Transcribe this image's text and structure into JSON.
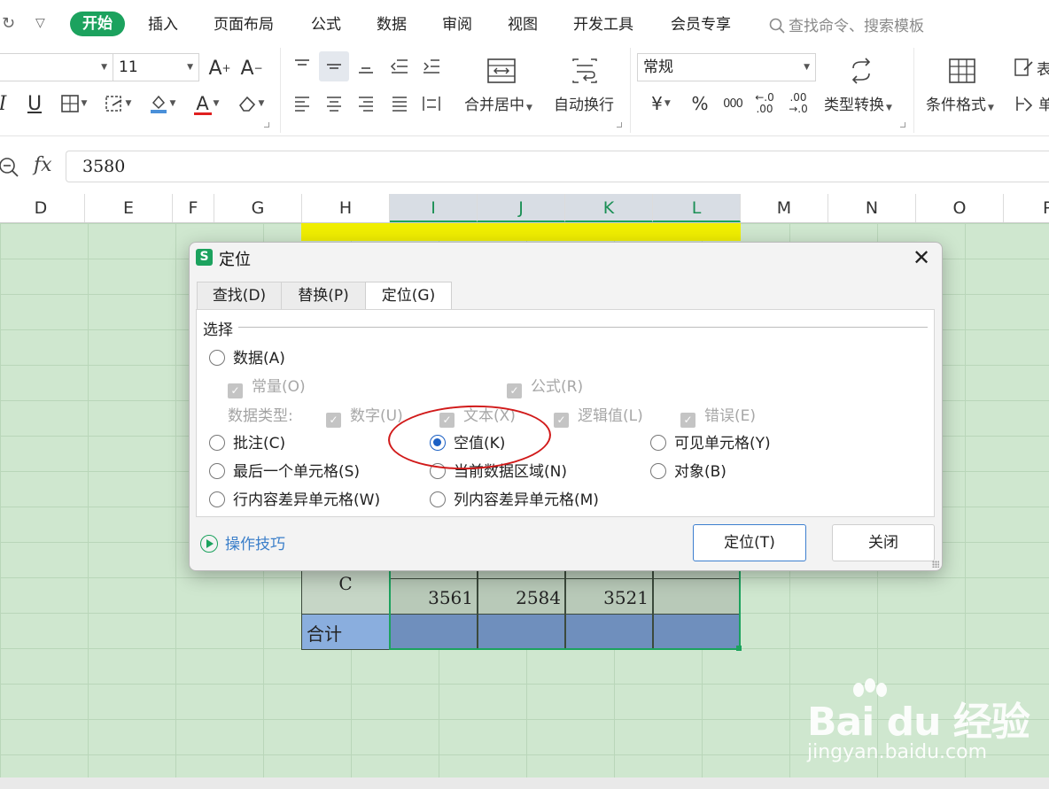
{
  "menu": {
    "tabs": [
      "开始",
      "插入",
      "页面布局",
      "公式",
      "数据",
      "审阅",
      "视图",
      "开发工具",
      "会员专享"
    ],
    "search_placeholder": "查找命令、搜索模板"
  },
  "ribbon": {
    "font_size": "11",
    "merge_label": "合并居中",
    "wrap_label": "自动换行",
    "number_format": "常规",
    "convert_label": "类型转换",
    "cond_format_label": "条件格式",
    "percent_symbol": "%",
    "thousands_symbol": "000",
    "inc_decimal": "←.0 .00",
    "dec_decimal": ".00 →.0",
    "currency_symbol": "¥",
    "cut_off_right_1": "表",
    "cut_off_right_2": "单"
  },
  "formula_bar": {
    "fx_label": "fx",
    "value": "3580"
  },
  "columns": [
    "D",
    "E",
    "F",
    "G",
    "H",
    "I",
    "J",
    "K",
    "L",
    "M",
    "N",
    "O",
    "P"
  ],
  "sheet": {
    "row_c_label": "C",
    "row_c_values": [
      "3561",
      "2584",
      "3521",
      ""
    ],
    "total_label": "合计"
  },
  "dialog": {
    "title": "定位",
    "tabs": [
      "查找(D)",
      "替换(P)",
      "定位(G)"
    ],
    "active_tab": "定位(G)",
    "group_label": "选择",
    "options": {
      "data": "数据(A)",
      "constant": "常量(O)",
      "formula": "公式(R)",
      "data_type_label": "数据类型:",
      "number": "数字(U)",
      "text": "文本(X)",
      "logical": "逻辑值(L)",
      "error": "错误(E)",
      "comment": "批注(C)",
      "blank": "空值(K)",
      "visible_cells": "可见单元格(Y)",
      "last_cell": "最后一个单元格(S)",
      "current_region": "当前数据区域(N)",
      "object": "对象(B)",
      "row_diff": "行内容差异单元格(W)",
      "col_diff": "列内容差异单元格(M)"
    },
    "selected_option": "空值(K)",
    "tips_label": "操作技巧",
    "goto_button": "定位(T)",
    "close_button": "关闭"
  },
  "watermark": {
    "brand": "Bai du 经验",
    "url": "jingyan.baidu.com"
  },
  "colors": {
    "accent_green": "#1ca25e",
    "sheet_green": "#cfe7cf",
    "highlight_yellow": "#f0ee00",
    "annotation_red": "#d11a1a"
  }
}
